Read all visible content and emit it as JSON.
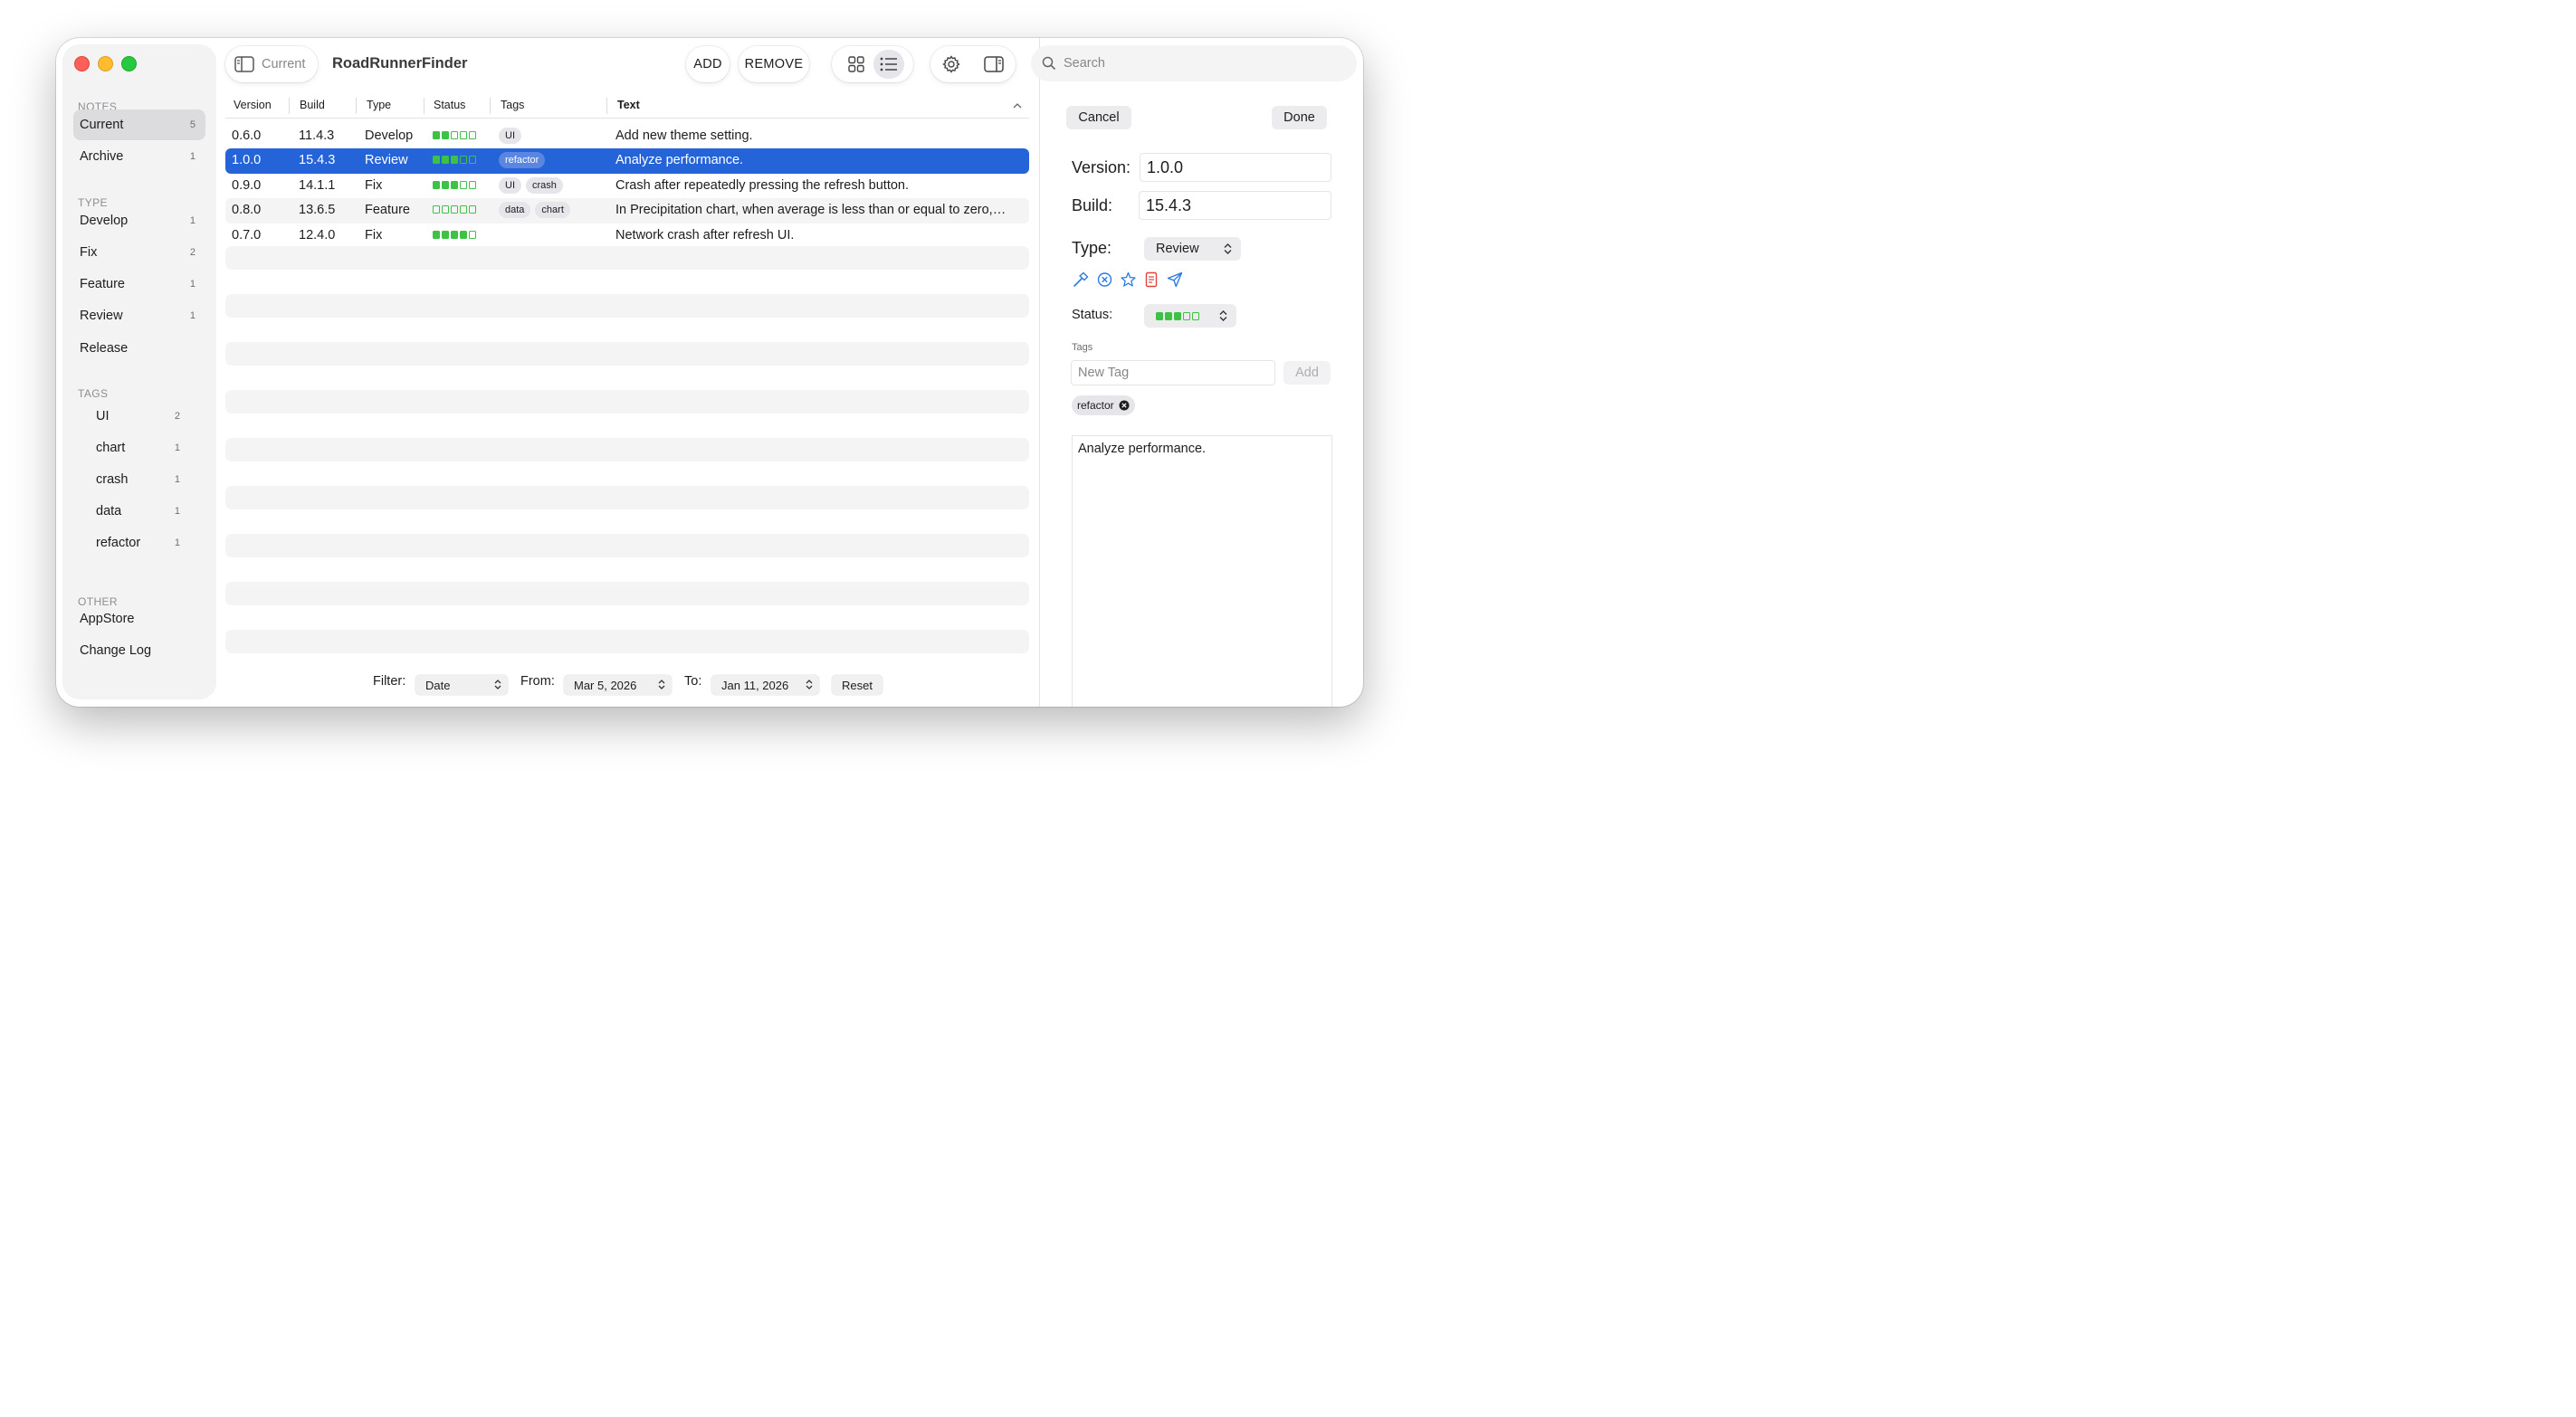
{
  "sidebar": {
    "sections": {
      "notes": "NOTES",
      "type": "TYPE",
      "tags": "TAGS",
      "other": "OTHER"
    },
    "notes": [
      {
        "label": "Current",
        "count": "5",
        "selected": true
      },
      {
        "label": "Archive",
        "count": "1"
      }
    ],
    "types": [
      {
        "label": "Develop",
        "count": "1"
      },
      {
        "label": "Fix",
        "count": "2"
      },
      {
        "label": "Feature",
        "count": "1"
      },
      {
        "label": "Review",
        "count": "1"
      },
      {
        "label": "Release",
        "count": ""
      }
    ],
    "tags": [
      {
        "label": "UI",
        "count": "2"
      },
      {
        "label": "chart",
        "count": "1"
      },
      {
        "label": "crash",
        "count": "1"
      },
      {
        "label": "data",
        "count": "1"
      },
      {
        "label": "refactor",
        "count": "1"
      }
    ],
    "other": [
      {
        "label": "AppStore"
      },
      {
        "label": "Change Log"
      }
    ]
  },
  "toolbar": {
    "breadcrumb": "Current",
    "title": "RoadRunnerFinder",
    "add_label": "ADD",
    "remove_label": "REMOVE",
    "search_placeholder": "Search"
  },
  "table": {
    "columns": [
      "Version",
      "Build",
      "Type",
      "Status",
      "Tags",
      "Text"
    ],
    "rows": [
      {
        "version": "0.6.0",
        "build": "11.4.3",
        "type": "Develop",
        "status": 2,
        "tags": [
          "UI"
        ],
        "text": "Add new theme setting."
      },
      {
        "version": "1.0.0",
        "build": "15.4.3",
        "type": "Review",
        "status": 3,
        "tags": [
          "refactor"
        ],
        "text": "Analyze performance.",
        "selected": true
      },
      {
        "version": "0.9.0",
        "build": "14.1.1",
        "type": "Fix",
        "status": 3,
        "tags": [
          "UI",
          "crash"
        ],
        "text": "Crash after repeatedly pressing the refresh button."
      },
      {
        "version": "0.8.0",
        "build": "13.6.5",
        "type": "Feature",
        "status": 0,
        "tags": [
          "data",
          "chart"
        ],
        "text": "In Precipitation chart, when average is less than or equal to zero,…"
      },
      {
        "version": "0.7.0",
        "build": "12.4.0",
        "type": "Fix",
        "status": 4,
        "tags": [],
        "text": "Network crash after refresh UI."
      }
    ]
  },
  "filter": {
    "filter_label": "Filter:",
    "filter_value": "Date",
    "from_label": "From:",
    "from_value": "Mar 5, 2026",
    "to_label": "To:",
    "to_value": "Jan 11, 2026",
    "reset_label": "Reset"
  },
  "detail": {
    "cancel_label": "Cancel",
    "done_label": "Done",
    "version_label": "Version:",
    "version_value": "1.0.0",
    "build_label": "Build:",
    "build_value": "15.4.3",
    "type_label": "Type:",
    "type_value": "Review",
    "status_label": "Status:",
    "status_value": 3,
    "tags_label": "Tags",
    "new_tag_placeholder": "New Tag",
    "add_label": "Add",
    "tag_chip": "refactor",
    "text": "Analyze performance."
  },
  "colors": {
    "accent": "#2563d8",
    "status_green": "#3ec245",
    "icon_blue": "#2a7ae2",
    "icon_red": "#e0443e"
  }
}
